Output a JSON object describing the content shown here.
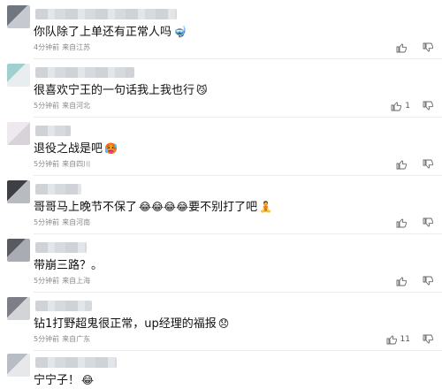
{
  "comments": [
    {
      "text": "你队除了上单还有正常人吗",
      "emoji": "🤿",
      "time": "4分钟前",
      "location": "来自江苏",
      "likes": ""
    },
    {
      "text": "很喜欢宁王的一句话我上我也行",
      "emoji": "😼",
      "time": "5分钟前",
      "location": "来自河北",
      "likes": "1"
    },
    {
      "text": "退役之战是吧",
      "emoji": "🥵",
      "time": "5分钟前",
      "location": "来自四川",
      "likes": ""
    },
    {
      "text": "哥哥马上晚节不保了",
      "emoji": "😂😂😂😂",
      "after_text": "要不别打了吧",
      "after_emoji": "🧘",
      "time": "5分钟前",
      "location": "来自河南",
      "likes": ""
    },
    {
      "text": "带崩三路？。",
      "emoji": "",
      "time": "5分钟前",
      "location": "来自上海",
      "likes": ""
    },
    {
      "text": "钻1打野超鬼很正常，up经理的福报",
      "emoji": "😞",
      "time": "5分钟前",
      "location": "来自广东",
      "likes": "11"
    },
    {
      "text": "宁宁子！",
      "emoji": "😂",
      "time": "",
      "location": "",
      "likes": ""
    }
  ],
  "icons": {
    "like": "thumb-up-icon",
    "dislike": "thumb-down-icon"
  }
}
